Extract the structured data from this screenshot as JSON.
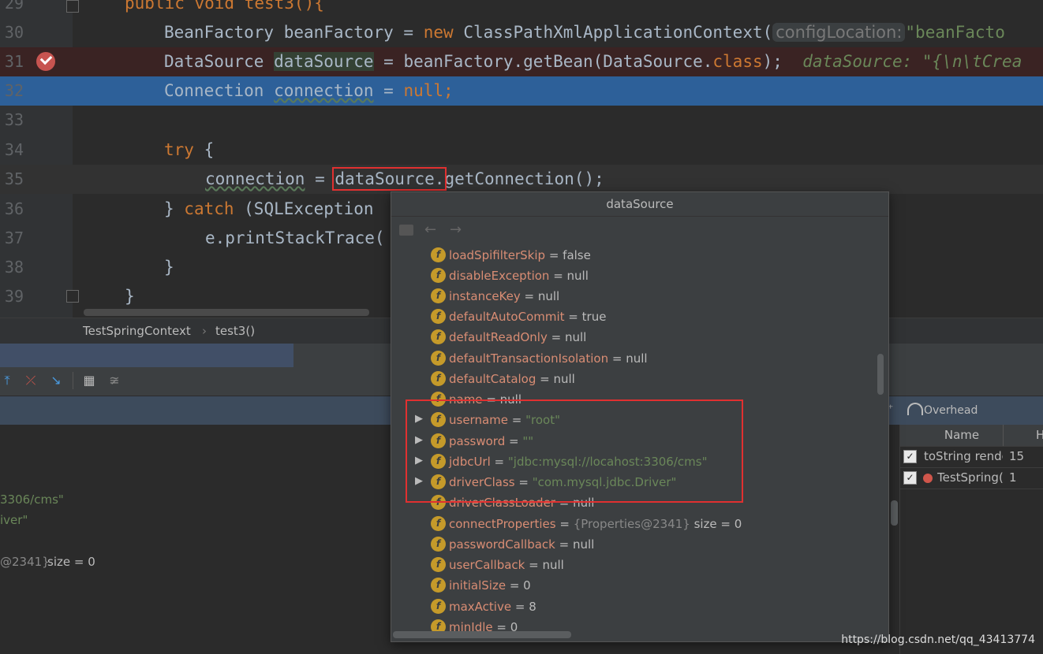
{
  "editor": {
    "lines": [
      {
        "num": "29"
      },
      {
        "num": "30",
        "segs": [
          "BeanFactory beanFactory = ",
          "new",
          " ClassPathXmlApplicationContext(",
          "configLocation:",
          "\"beanFacto"
        ]
      },
      {
        "num": "31",
        "segs": [
          "DataSource ",
          "dataSource",
          " = beanFactory.getBean(DataSource.",
          "class",
          ");  ",
          "dataSource: \"{\\n\\tCrea"
        ]
      },
      {
        "num": "32",
        "segs": [
          "Connection ",
          "connection",
          " = ",
          "null;"
        ]
      },
      {
        "num": "33"
      },
      {
        "num": "34",
        "segs": [
          "try",
          " {"
        ]
      },
      {
        "num": "35",
        "segs": [
          "connection",
          " = ",
          "dataSource.",
          "getConnection();"
        ]
      },
      {
        "num": "36",
        "segs": [
          "} ",
          "catch",
          " (SQLException"
        ]
      },
      {
        "num": "37",
        "segs": [
          "e.printStackTrace("
        ]
      },
      {
        "num": "38",
        "segs": [
          "}"
        ]
      },
      {
        "num": "39",
        "segs": [
          "}"
        ]
      }
    ],
    "line29_partial": "public void test3(){"
  },
  "breadcrumb": {
    "class_name": "TestSpringContext",
    "method_name": "test3()"
  },
  "popup": {
    "title": "dataSource",
    "fields": [
      {
        "name": "loadSpifilterSkip",
        "value": "false"
      },
      {
        "name": "disableException",
        "value": "null"
      },
      {
        "name": "instanceKey",
        "value": "null"
      },
      {
        "name": "defaultAutoCommit",
        "value": "true"
      },
      {
        "name": "defaultReadOnly",
        "value": "null"
      },
      {
        "name": "defaultTransactionIsolation",
        "value": "null"
      },
      {
        "name": "defaultCatalog",
        "value": "null"
      },
      {
        "name": "name",
        "value": "null"
      },
      {
        "name": "username",
        "value": "\"root\""
      },
      {
        "name": "password",
        "value": "\"\""
      },
      {
        "name": "jdbcUrl",
        "value": "\"jdbc:mysql://locahost:3306/cms\""
      },
      {
        "name": "driverClass",
        "value": "\"com.mysql.jdbc.Driver\""
      },
      {
        "name": "driverClassLoader",
        "value": "null"
      },
      {
        "name": "connectProperties",
        "value": "{Properties@2341}",
        "extra": "size = 0"
      },
      {
        "name": "passwordCallback",
        "value": "null"
      },
      {
        "name": "userCallback",
        "value": "null"
      },
      {
        "name": "initialSize",
        "value": "0"
      },
      {
        "name": "maxActive",
        "value": "8"
      },
      {
        "name": "minIdle",
        "value": "0"
      }
    ]
  },
  "debug": {
    "left_values": [
      "3306/cms\"",
      "iver\"",
      "@2341}",
      "size = 0"
    ],
    "overhead_label": "Overhead",
    "table": {
      "header": "Name",
      "header2": "H",
      "rows": [
        {
          "name": "toString rende",
          "count": "15"
        },
        {
          "name": "TestSpring(",
          "count": "1"
        }
      ]
    }
  },
  "watermark": "https://blog.csdn.net/qq_43413774"
}
